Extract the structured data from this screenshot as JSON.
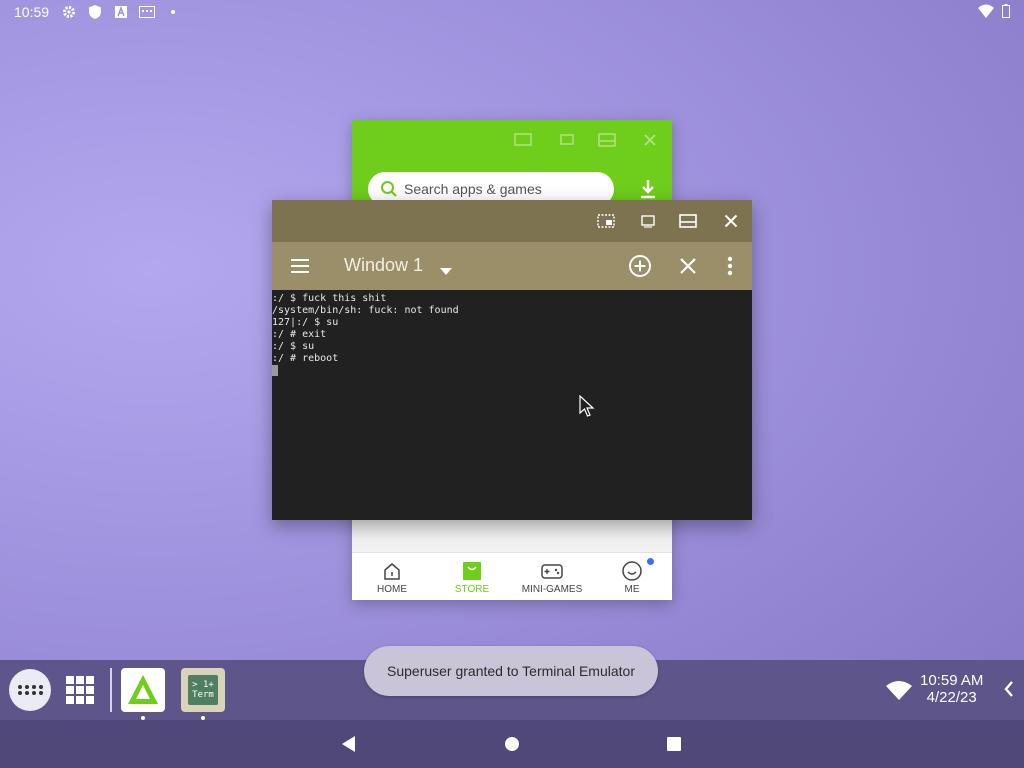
{
  "status_bar": {
    "time": "10:59",
    "icons": [
      "gear-icon",
      "shield-icon",
      "font-a-icon",
      "keyboard-icon",
      "dot-icon"
    ],
    "right_icons": [
      "wifi-icon",
      "battery-icon"
    ]
  },
  "apkpure": {
    "search_placeholder": "Search apps & games",
    "accent_color": "#6fcd1c",
    "nav": [
      {
        "label": "HOME",
        "icon": "house-icon"
      },
      {
        "label": "STORE",
        "icon": "bag-icon",
        "active": true
      },
      {
        "label": "MINI-GAMES",
        "icon": "gamepad-icon"
      },
      {
        "label": "ME",
        "icon": "face-icon",
        "badge": true
      }
    ]
  },
  "terminal": {
    "window_title": "Window 1",
    "caption_bg": "#7d7350",
    "toolbar_bg": "#9a8f68",
    "lines": [
      ":/ $ fuck this shit",
      "/system/bin/sh: fuck: not found",
      "127|:/ $ su",
      ":/ # exit",
      ":/ $ su",
      ":/ # reboot"
    ]
  },
  "taskbar": {
    "apps": [
      {
        "name": "APKPure",
        "icon": "apkpure-icon"
      },
      {
        "name": "Terminal",
        "icon_text_top": "> 1+",
        "icon_text_bottom": "Term"
      }
    ],
    "clock_time": "10:59 AM",
    "clock_date": "4/22/23"
  },
  "toast": {
    "text": "Superuser granted to Terminal Emulator"
  }
}
